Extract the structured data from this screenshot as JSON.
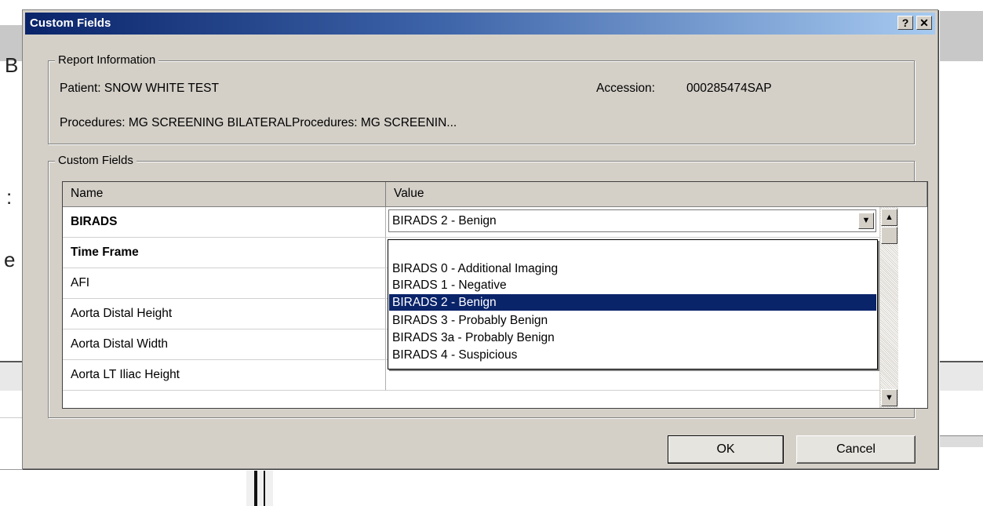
{
  "background": {
    "letters": [
      "B",
      ":",
      "e"
    ]
  },
  "dialog": {
    "title": "Custom Fields",
    "help_label": "?",
    "close_label": "✕"
  },
  "report_info": {
    "legend": "Report Information",
    "patient": "Patient:  SNOW WHITE TEST",
    "accession_label": "Accession:",
    "accession_value": "000285474SAP",
    "procedures": "Procedures:  MG SCREENING BILATERALProcedures:  MG SCREENIN..."
  },
  "custom_fields": {
    "legend": "Custom Fields",
    "columns": [
      "Name",
      "Value"
    ],
    "rows": [
      {
        "name": "BIRADS",
        "value": "BIRADS 2 - Benign"
      },
      {
        "name": "Time Frame",
        "value": ""
      },
      {
        "name": "AFI",
        "value": ""
      },
      {
        "name": "Aorta Distal Height",
        "value": ""
      },
      {
        "name": "Aorta Distal Width",
        "value": ""
      },
      {
        "name": "Aorta LT Iliac Height",
        "value": ""
      }
    ],
    "dropdown_options": [
      "",
      "BIRADS 0 - Additional Imaging",
      "BIRADS 1 - Negative",
      "BIRADS 2 - Benign",
      "BIRADS 3 - Probably Benign",
      "BIRADS 3a - Probably Benign",
      "BIRADS 4 - Suspicious"
    ],
    "selected_option": "BIRADS 2 - Benign"
  },
  "buttons": {
    "ok": "OK",
    "cancel": "Cancel"
  },
  "icons": {
    "combo_arrow": "chevron-down-icon",
    "scroll_up": "arrow-up-icon",
    "scroll_down": "arrow-down-icon"
  },
  "colors": {
    "title_bar": "#0a246a",
    "selection": "#0a246a",
    "dialog_face": "#d4d0c8"
  }
}
